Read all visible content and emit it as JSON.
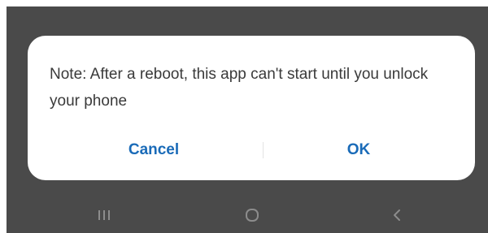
{
  "dialog": {
    "message": "Note: After a reboot, this app can't start until you unlock your phone",
    "cancel_label": "Cancel",
    "ok_label": "OK"
  },
  "nav_bar": {
    "icons": [
      "recent-apps-icon",
      "home-icon",
      "back-icon"
    ]
  },
  "colors": {
    "scrim": "#4a4a4a",
    "dialog_background": "#ffffff",
    "message_text": "#3a3a3a",
    "button_text": "#1a6bb8",
    "nav_icon": "#8c8c8c"
  }
}
